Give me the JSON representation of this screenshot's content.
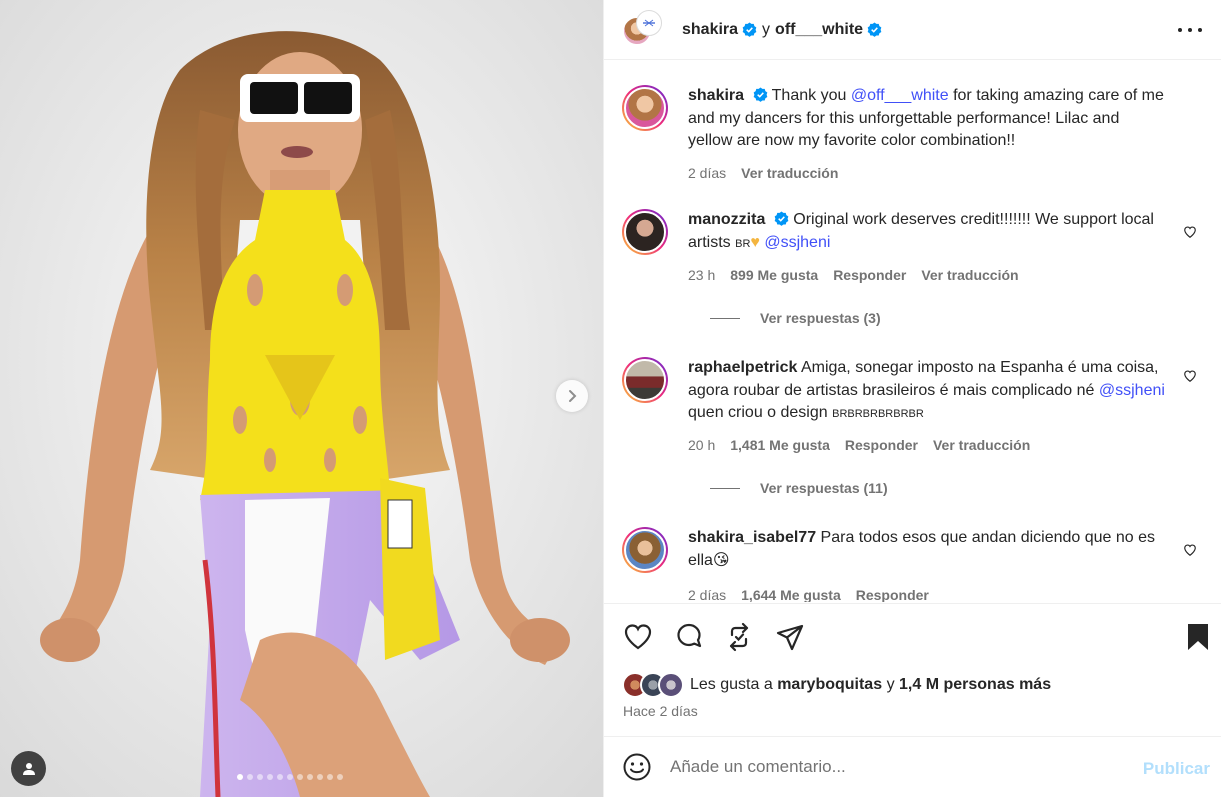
{
  "header": {
    "author": "shakira",
    "conjunction": "y",
    "coauthor": "off___white",
    "more_icon": "more-horizontal-icon"
  },
  "caption": {
    "username": "shakira",
    "prefix": "Thank you",
    "mention": "@off___white",
    "suffix": "for taking amazing care of me and my dancers for this unforgettable performance! Lilac and yellow are now my favorite color combination!!",
    "time": "2 días",
    "translate": "Ver traducción"
  },
  "comments": [
    {
      "username": "manozzita",
      "verified": true,
      "text": "Original work deserves credit!!!!!!! We support local artists",
      "flag": "BR",
      "mention": "@ssjheni",
      "time": "23 h",
      "likes": "899 Me gusta",
      "reply": "Responder",
      "translate": "Ver traducción",
      "replies": "Ver respuestas (3)"
    },
    {
      "username": "raphaelpetrick",
      "text": "Amiga, sonegar imposto na Espanha é uma coisa, agora roubar de artistas brasileiros é mais complicado né",
      "mention": "@ssjheni",
      "text2": "quen criou o design",
      "flags": "BRBRBRBRBRBR",
      "time": "20 h",
      "likes": "1,481 Me gusta",
      "reply": "Responder",
      "translate": "Ver traducción",
      "replies": "Ver respuestas (11)"
    },
    {
      "username": "shakira_isabel77",
      "text": "Para todos esos que andan diciendo que no es ella",
      "emoji": "😘",
      "time": "2 días",
      "likes": "1,644 Me gusta",
      "reply": "Responder"
    }
  ],
  "actions": {
    "like_icon": "heart-icon",
    "comment_icon": "comment-icon",
    "repost_icon": "repost-icon",
    "share_icon": "share-icon",
    "save_icon": "bookmark-icon"
  },
  "likes": {
    "prefix": "Les gusta a",
    "first_user": "maryboquitas",
    "and": "y",
    "others": "1,4 M personas más"
  },
  "posted": "Hace 2 días",
  "composer": {
    "placeholder": "Añade un comentario...",
    "publish": "Publicar"
  },
  "carousel": {
    "slides": 11,
    "active_slide": 1
  },
  "colors": {
    "link": "#4150f7",
    "publish_disabled": "#b2dffc",
    "verified": "#0095f6"
  }
}
